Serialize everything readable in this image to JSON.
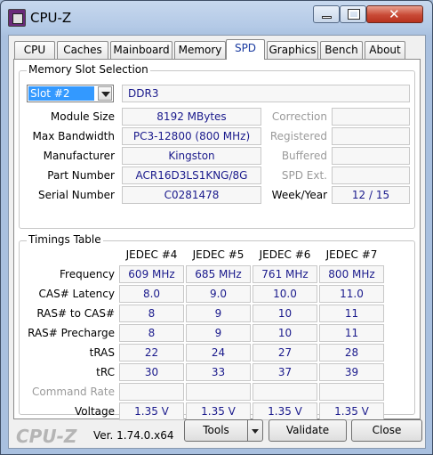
{
  "window": {
    "title": "CPU-Z"
  },
  "tabs": [
    {
      "label": "CPU"
    },
    {
      "label": "Caches"
    },
    {
      "label": "Mainboard"
    },
    {
      "label": "Memory"
    },
    {
      "label": "SPD"
    },
    {
      "label": "Graphics"
    },
    {
      "label": "Bench"
    },
    {
      "label": "About"
    }
  ],
  "active_tab": "SPD",
  "slot": {
    "group_title": "Memory Slot Selection",
    "selected": "Slot #2",
    "type": "DDR3",
    "module_size_label": "Module Size",
    "module_size": "8192 MBytes",
    "max_bandwidth_label": "Max Bandwidth",
    "max_bandwidth": "PC3-12800 (800 MHz)",
    "manufacturer_label": "Manufacturer",
    "manufacturer": "Kingston",
    "part_number_label": "Part Number",
    "part_number": "ACR16D3LS1KNG/8G",
    "serial_number_label": "Serial Number",
    "serial_number": "C0281478",
    "correction_label": "Correction",
    "correction": "",
    "registered_label": "Registered",
    "registered": "",
    "buffered_label": "Buffered",
    "buffered": "",
    "spd_ext_label": "SPD Ext.",
    "spd_ext": "",
    "week_year_label": "Week/Year",
    "week_year": "12 / 15"
  },
  "timings": {
    "group_title": "Timings Table",
    "columns": [
      "JEDEC #4",
      "JEDEC #5",
      "JEDEC #6",
      "JEDEC #7"
    ],
    "rows": [
      {
        "label": "Frequency",
        "values": [
          "609 MHz",
          "685 MHz",
          "761 MHz",
          "800 MHz"
        ]
      },
      {
        "label": "CAS# Latency",
        "values": [
          "8.0",
          "9.0",
          "10.0",
          "11.0"
        ]
      },
      {
        "label": "RAS# to CAS#",
        "values": [
          "8",
          "9",
          "10",
          "11"
        ]
      },
      {
        "label": "RAS# Precharge",
        "values": [
          "8",
          "9",
          "10",
          "11"
        ]
      },
      {
        "label": "tRAS",
        "values": [
          "22",
          "24",
          "27",
          "28"
        ]
      },
      {
        "label": "tRC",
        "values": [
          "30",
          "33",
          "37",
          "39"
        ]
      },
      {
        "label": "Command Rate",
        "values": [
          "",
          "",
          "",
          ""
        ]
      },
      {
        "label": "Voltage",
        "values": [
          "1.35 V",
          "1.35 V",
          "1.35 V",
          "1.35 V"
        ]
      }
    ]
  },
  "footer": {
    "logo": "CPU-Z",
    "version": "Ver. 1.74.0.x64",
    "tools_label": "Tools",
    "validate_label": "Validate",
    "close_label": "Close"
  }
}
